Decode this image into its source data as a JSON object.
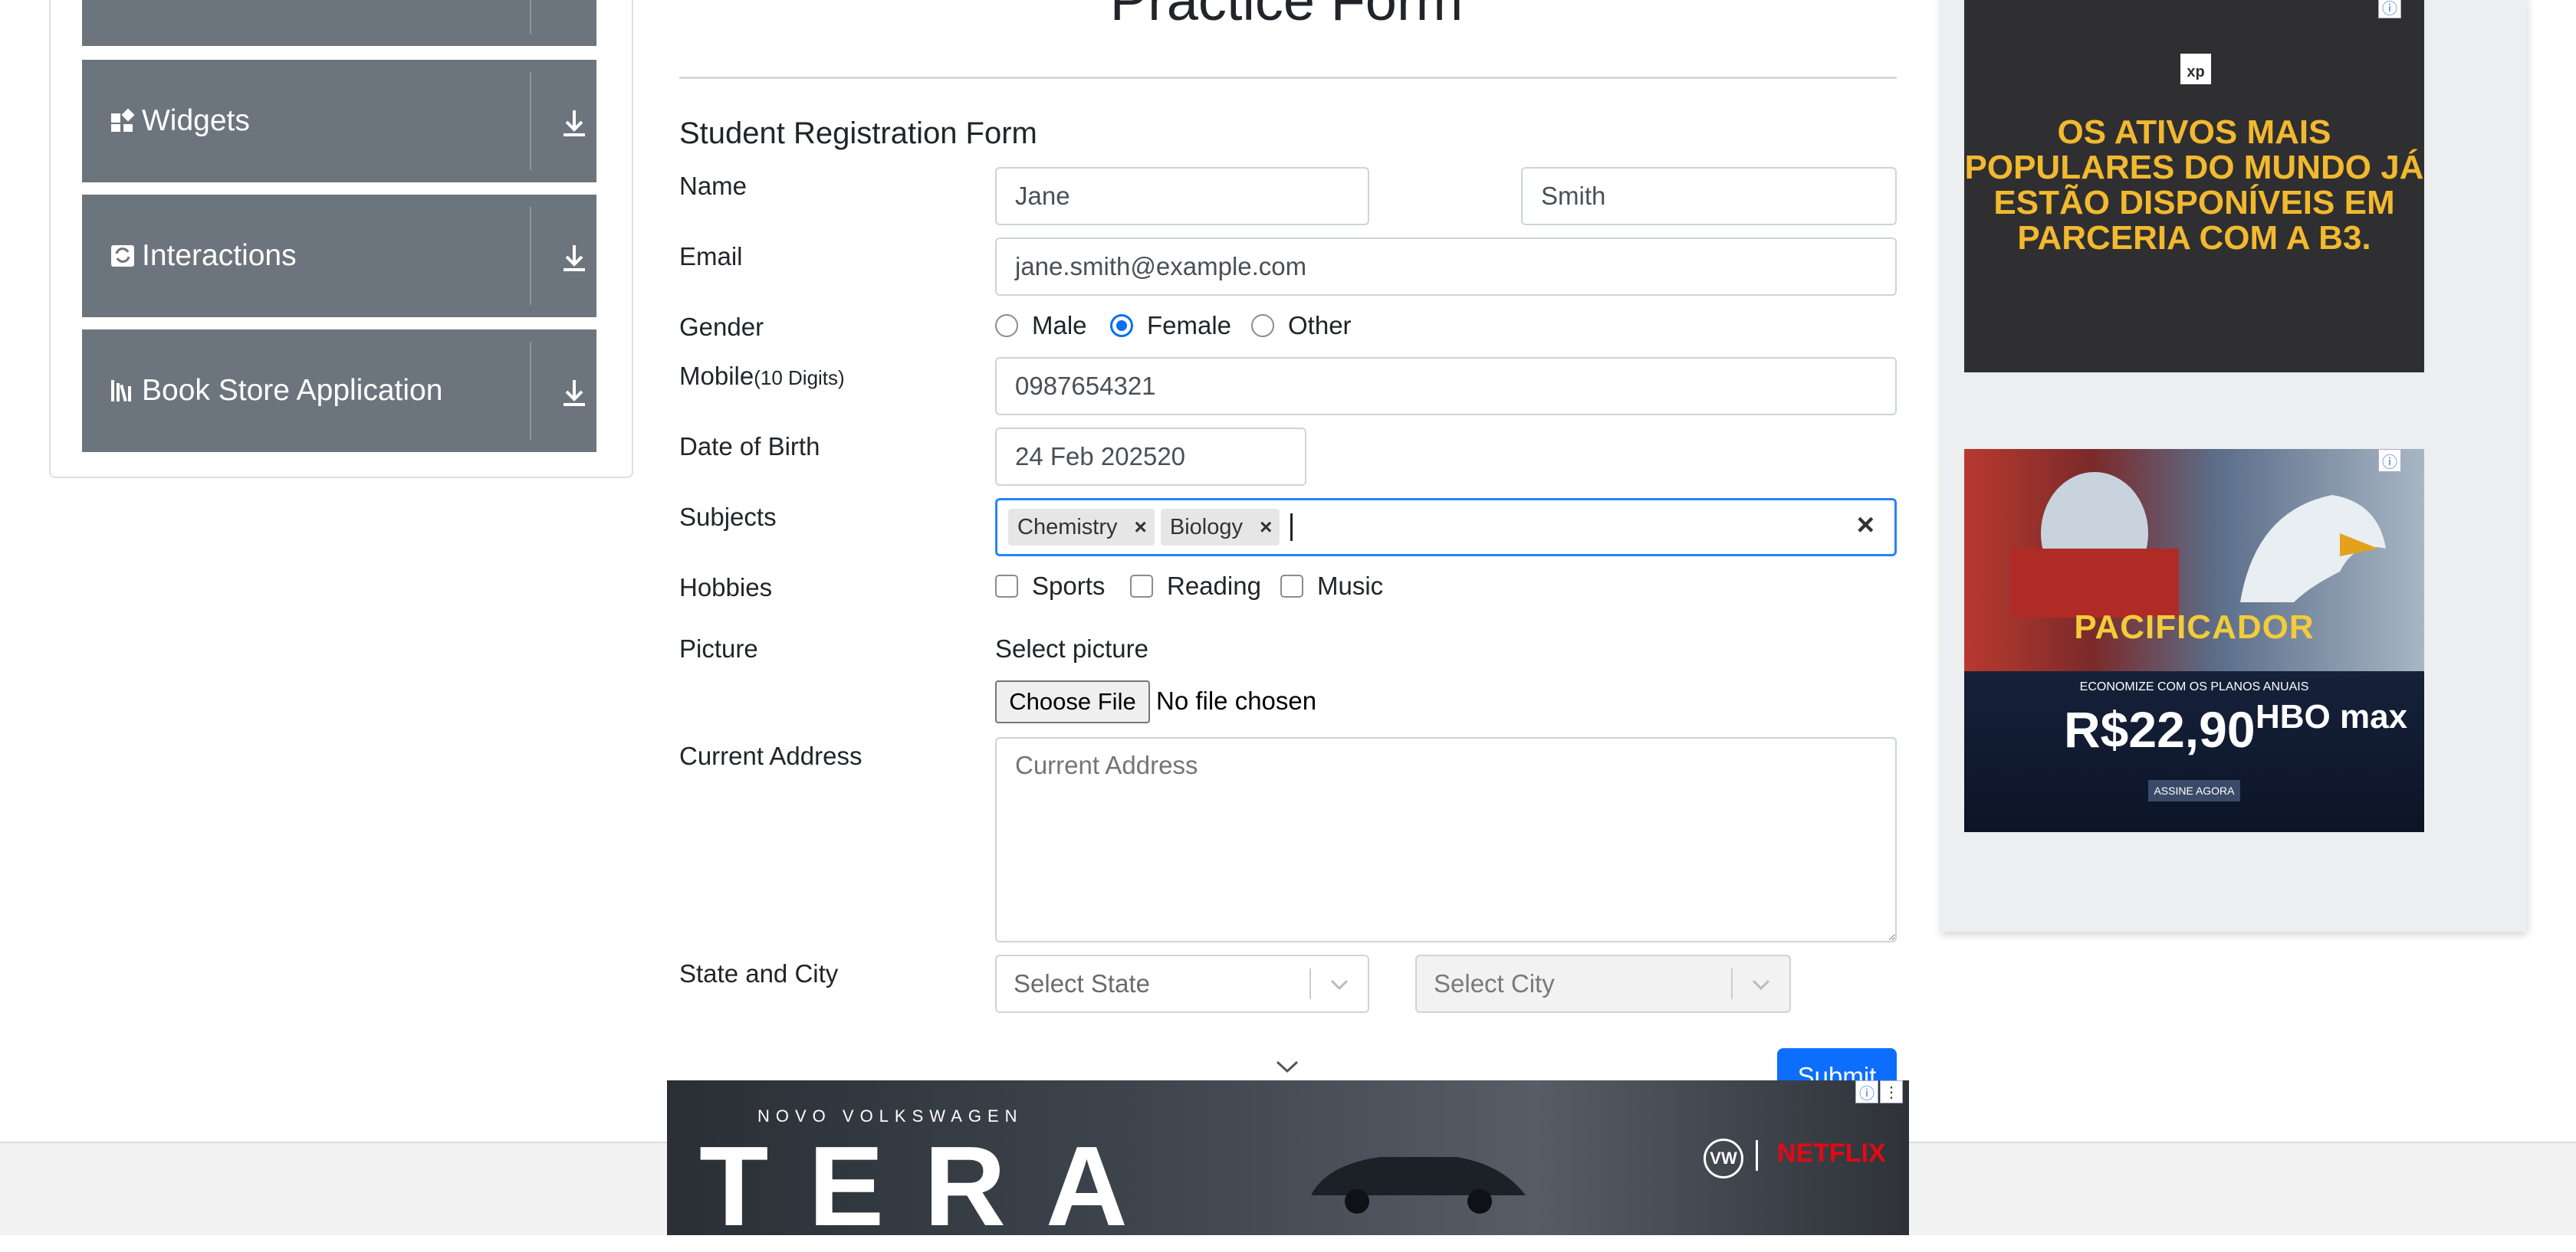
{
  "sidebar": {
    "groups": [
      {
        "label": "Widgets",
        "icon": "widgets-icon"
      },
      {
        "label": "Interactions",
        "icon": "interactions-icon"
      },
      {
        "label": "Book Store Application",
        "icon": "bookstore-icon"
      }
    ]
  },
  "form": {
    "page_title": "Practice Form",
    "heading": "Student Registration Form",
    "name_label": "Name",
    "first_name": "Jane",
    "last_name": "Smith",
    "email_label": "Email",
    "email": "jane.smith@example.com",
    "gender_label": "Gender",
    "gender_options": [
      "Male",
      "Female",
      "Other"
    ],
    "gender_selected": "Female",
    "mobile_label": "Mobile",
    "mobile_hint": "(10 Digits)",
    "mobile": "0987654321",
    "dob_label": "Date of Birth",
    "dob": "24 Feb 202520",
    "subjects_label": "Subjects",
    "subjects": [
      "Chemistry",
      "Biology"
    ],
    "clear_symbol": "×",
    "hobbies_label": "Hobbies",
    "hobbies": [
      "Sports",
      "Reading",
      "Music"
    ],
    "picture_label": "Picture",
    "picture_hint": "Select picture",
    "choose_file": "Choose File",
    "no_file": "No file chosen",
    "address_label": "Current Address",
    "address_placeholder": "Current Address",
    "state_city_label": "State and City",
    "state_placeholder": "Select State",
    "city_placeholder": "Select City",
    "submit": "Submit"
  },
  "ads": {
    "ad1_text": "OS ATIVOS MAIS POPULARES DO MUNDO JÁ ESTÃO DISPONÍVEIS EM PARCERIA COM A B3.",
    "ad2_title": "PACIFICADOR",
    "ad2_sub": "ECONOMIZE COM OS PLANOS ANUAIS",
    "ad2_price": "R$22,90",
    "ad2_brand": "HBO max",
    "ad2_button": "ASSINE AGORA",
    "ad3_kicker": "NOVO VOLKSWAGEN",
    "ad3_title": "TERA",
    "ad3_partner": "NETFLIX",
    "adchoice_symbol": "ⓘ"
  },
  "colors": {
    "primary": "#0d6efd",
    "sidebar_group": "#6c757d",
    "ad_yellow": "#f2b92f"
  }
}
